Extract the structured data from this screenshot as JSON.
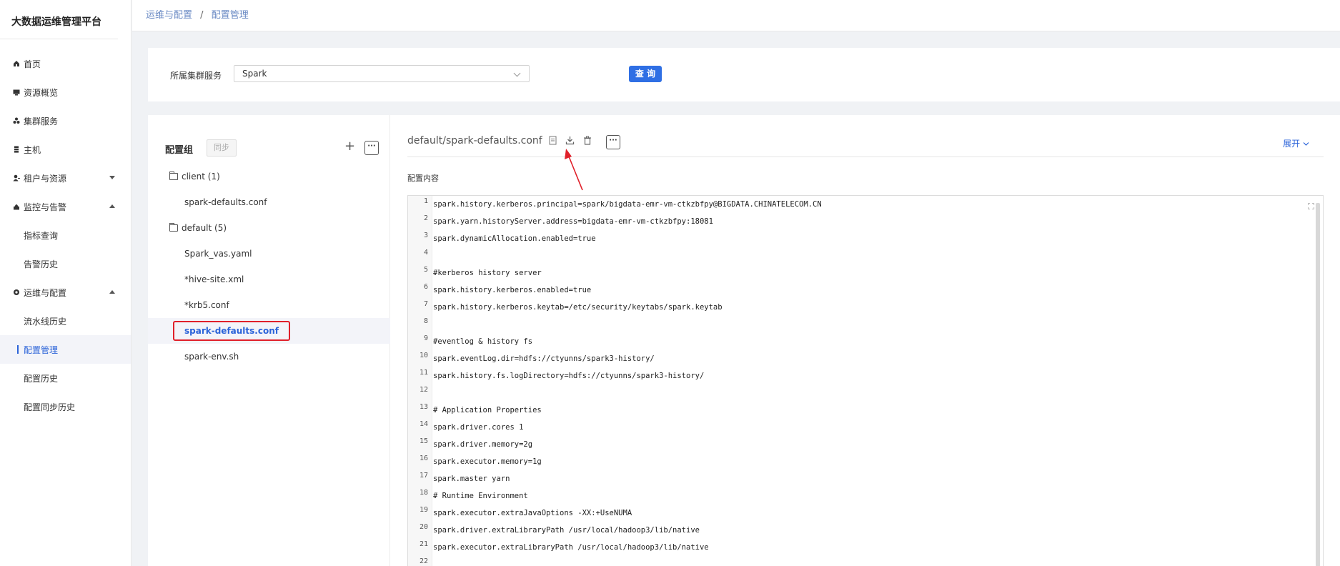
{
  "app": {
    "title": "大数据运维管理平台"
  },
  "sidebar": {
    "items": [
      {
        "label": "首页",
        "icon": "home-icon"
      },
      {
        "label": "资源概览",
        "icon": "monitor-icon"
      },
      {
        "label": "集群服务",
        "icon": "cluster-icon"
      },
      {
        "label": "主机",
        "icon": "server-icon"
      },
      {
        "label": "租户与资源",
        "icon": "tenant-icon"
      },
      {
        "label": "监控与告警",
        "icon": "alarm-icon"
      },
      {
        "label": "指标查询"
      },
      {
        "label": "告警历史"
      },
      {
        "label": "运维与配置",
        "icon": "ops-icon"
      },
      {
        "label": "流水线历史"
      },
      {
        "label": "配置管理"
      },
      {
        "label": "配置历史"
      },
      {
        "label": "配置同步历史"
      }
    ]
  },
  "breadcrumb": {
    "parent": "运维与配置",
    "separator": "/",
    "current": "配置管理"
  },
  "filter": {
    "label": "所属集群服务",
    "selected": "Spark",
    "query_button": "查 询"
  },
  "config_group": {
    "title": "配置组",
    "sync_button": "同步",
    "add_button": "+",
    "more_button": "···",
    "tree": [
      {
        "label": "client (1)"
      },
      {
        "label": "spark-defaults.conf"
      },
      {
        "label": "default (5)"
      },
      {
        "label": "Spark_vas.yaml"
      },
      {
        "label": "*hive-site.xml"
      },
      {
        "label": "*krb5.conf"
      },
      {
        "label": "spark-defaults.conf"
      },
      {
        "label": "spark-env.sh"
      }
    ]
  },
  "editor_panel": {
    "file_title": "default/spark-defaults.conf",
    "more_button": "···",
    "expand_label": "展开",
    "content_label": "配置内容",
    "icons": [
      "document-icon",
      "download-icon",
      "trash-icon"
    ],
    "annotation_color": "#e0202a",
    "lines": [
      {
        "n": "1",
        "text": "spark.history.kerberos.principal=spark/bigdata-emr-vm-ctkzbfpy@BIGDATA.CHINATELECOM.CN"
      },
      {
        "n": "2",
        "text": "spark.yarn.historyServer.address=bigdata-emr-vm-ctkzbfpy:18081"
      },
      {
        "n": "3",
        "text": "spark.dynamicAllocation.enabled=true"
      },
      {
        "n": "4",
        "text": ""
      },
      {
        "n": "5",
        "text": "#kerberos history server"
      },
      {
        "n": "6",
        "text": "spark.history.kerberos.enabled=true"
      },
      {
        "n": "7",
        "text": "spark.history.kerberos.keytab=/etc/security/keytabs/spark.keytab"
      },
      {
        "n": "8",
        "text": ""
      },
      {
        "n": "9",
        "text": "#eventlog & history fs"
      },
      {
        "n": "10",
        "text": "spark.eventLog.dir=hdfs://ctyunns/spark3-history/"
      },
      {
        "n": "11",
        "text": "spark.history.fs.logDirectory=hdfs://ctyunns/spark3-history/"
      },
      {
        "n": "12",
        "text": ""
      },
      {
        "n": "13",
        "text": "# Application Properties"
      },
      {
        "n": "14",
        "text": "spark.driver.cores 1"
      },
      {
        "n": "15",
        "text": "spark.driver.memory=2g"
      },
      {
        "n": "16",
        "text": "spark.executor.memory=1g"
      },
      {
        "n": "17",
        "text": "spark.master yarn"
      },
      {
        "n": "18",
        "text": "# Runtime Environment"
      },
      {
        "n": "19",
        "text": "spark.executor.extraJavaOptions -XX:+UseNUMA"
      },
      {
        "n": "20",
        "text": "spark.driver.extraLibraryPath /usr/local/hadoop3/lib/native"
      },
      {
        "n": "21",
        "text": "spark.executor.extraLibraryPath /usr/local/hadoop3/lib/native"
      },
      {
        "n": "22",
        "text": ""
      }
    ]
  }
}
